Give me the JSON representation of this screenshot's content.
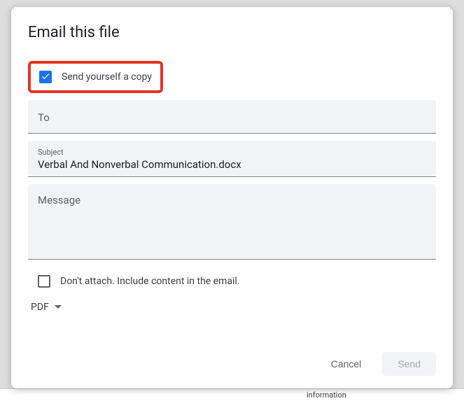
{
  "dialog": {
    "title": "Email this file",
    "sendCopy": {
      "label": "Send yourself a copy",
      "checked": true
    },
    "to": {
      "placeholder": "To"
    },
    "subject": {
      "label": "Subject",
      "value": "Verbal And Nonverbal Communication.docx"
    },
    "message": {
      "placeholder": "Message"
    },
    "dontAttach": {
      "label": "Don't attach. Include content in the email.",
      "checked": false
    },
    "format": {
      "label": "PDF"
    },
    "actions": {
      "cancel": "Cancel",
      "send": "Send"
    }
  },
  "backdrop": {
    "bottomText": "information"
  }
}
